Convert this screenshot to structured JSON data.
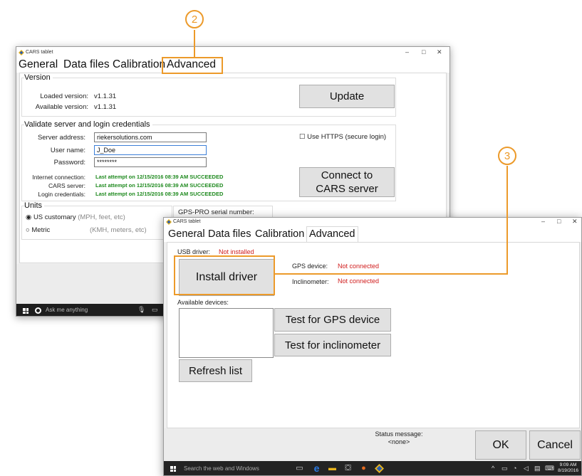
{
  "colors": {
    "accent_orange": "#ec9a2a",
    "ok_green": "#1f8a1f",
    "error_red": "#d01b1b"
  },
  "callouts": {
    "two": "2",
    "three": "3"
  },
  "window1": {
    "title": "CARS tablet",
    "controls": {
      "minimize": "–",
      "maximize": "□",
      "close": "✕"
    },
    "tabs": [
      "General",
      "Data files",
      "Calibration",
      "Advanced"
    ],
    "version": {
      "heading": "Version",
      "loaded_label": "Loaded version:",
      "loaded_value": "v1.1.31",
      "available_label": "Available version:",
      "available_value": "v1.1.31",
      "update_button": "Update"
    },
    "credentials": {
      "heading": "Validate server and login credentials",
      "server_label": "Server address:",
      "server_value": "riekersolutions.com",
      "user_label": "User name:",
      "user_value": "J_Doe",
      "password_label": "Password:",
      "password_value": "********",
      "https_label": "Use HTTPS (secure login)",
      "internet_label": "Internet connection:",
      "cars_label": "CARS server:",
      "login_label": "Login credentials:",
      "internet_status": "Last attempt on 12/15/2016 08:39 AM SUCCEEDED",
      "cars_status": "Last attempt on 12/15/2016 08:39 AM SUCCEEDED",
      "login_status": "Last attempt on 12/15/2016 08:39 AM SUCCEEDED",
      "connect_button_line1": "Connect to",
      "connect_button_line2": "CARS server"
    },
    "units": {
      "heading": "Units",
      "us_label": "US customary",
      "us_hint": "(MPH, feet, etc)",
      "metric_label": "Metric",
      "metric_hint": "(KMH, meters, etc)"
    },
    "gps_serial_label": "GPS-PRO serial number:",
    "taskbar": {
      "search": "Ask me anything"
    }
  },
  "window2": {
    "title": "CARS tablet",
    "controls": {
      "minimize": "–",
      "maximize": "□",
      "close": "✕"
    },
    "tabs": [
      "General",
      "Data files",
      "Calibration",
      "Advanced"
    ],
    "usb_driver_label": "USB driver:",
    "usb_driver_status": "Not installed",
    "install_button": "Install driver",
    "gps_device_label": "GPS device:",
    "gps_device_status": "Not connected",
    "inclinometer_label": "Inclinometer:",
    "inclinometer_status": "Not connected",
    "available_devices_label": "Available devices:",
    "test_gps_button": "Test for GPS device",
    "test_incl_button": "Test for inclinometer",
    "refresh_button": "Refresh list",
    "status_message_label": "Status message:",
    "status_message_value": "<none>",
    "ok_button": "OK",
    "cancel_button": "Cancel",
    "taskbar": {
      "search": "Search the web and Windows",
      "clock_time": "9:09 AM",
      "clock_date": "8/19/2016"
    }
  }
}
